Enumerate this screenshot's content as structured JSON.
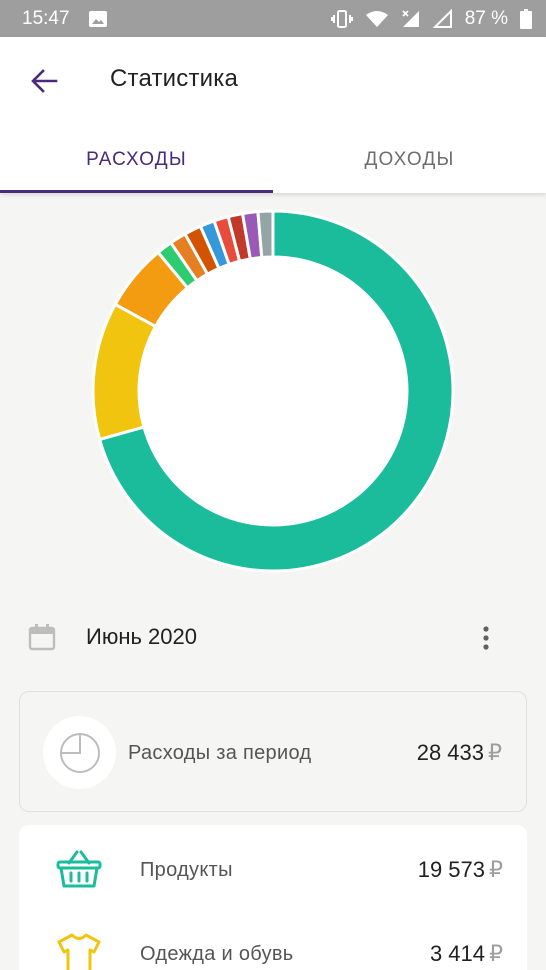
{
  "status_bar": {
    "time": "15:47",
    "battery": "87 %"
  },
  "app_bar": {
    "title": "Статистика"
  },
  "tabs": [
    {
      "label": "РАСХОДЫ",
      "active": true
    },
    {
      "label": "ДОХОДЫ",
      "active": false
    }
  ],
  "colors": {
    "accent": "#4a2a7a",
    "teal": "#1abc9c",
    "yellow": "#f1c40f"
  },
  "chart_data": {
    "type": "pie",
    "series": [
      {
        "value": 19573,
        "color": "#1abc9c"
      },
      {
        "value": 3414,
        "color": "#f1c40f"
      },
      {
        "value": 1660,
        "color": "#f39c12"
      },
      {
        "value": 390,
        "color": "#2ecc71"
      },
      {
        "value": 410,
        "color": "#e67e22"
      },
      {
        "value": 420,
        "color": "#d35400"
      },
      {
        "value": 360,
        "color": "#3498db"
      },
      {
        "value": 360,
        "color": "#e74c3c"
      },
      {
        "value": 360,
        "color": "#c0392b"
      },
      {
        "value": 380,
        "color": "#9b59b6"
      },
      {
        "value": 370,
        "color": "#95a5a6"
      }
    ]
  },
  "period": {
    "label": "Июнь 2020"
  },
  "summary": {
    "label": "Расходы за период",
    "amount": "28 433",
    "currency": "₽"
  },
  "categories": [
    {
      "label": "Продукты",
      "amount": "19 573",
      "currency": "₽",
      "icon": "basket-icon",
      "color": "#1abc9c"
    },
    {
      "label": "Одежда и обувь",
      "amount": "3 414",
      "currency": "₽",
      "icon": "tshirt-icon",
      "color": "#f1c40f"
    }
  ]
}
